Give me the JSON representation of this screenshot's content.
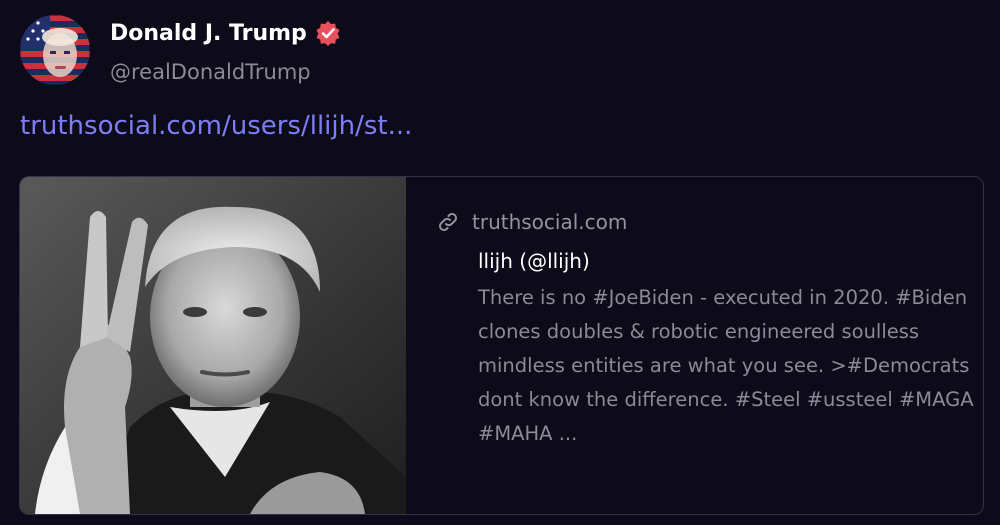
{
  "author": {
    "name": "Donald J. Trump",
    "handle": "@realDonaldTrump",
    "verified": true,
    "avatar_icon": "avatar-flag-face"
  },
  "post": {
    "link_text": "truthsocial.com/users/llijh/st..."
  },
  "link_card": {
    "domain": "truthsocial.com",
    "title": "llijh (@llijh)",
    "description": "There is no #JoeBiden - executed in 2020. #Biden clones doubles & robotic engineered soulless mindless entities are what you see. >#Democrats dont know the difference. #Steel #ussteel #MAGA #MAHA ...",
    "image": "photo-peace-sign"
  },
  "colors": {
    "background": "#0d0a1a",
    "link": "#7d7ef7",
    "verified_badge": "#e8505b",
    "muted_text": "#8c8a96",
    "card_border": "#34314a"
  }
}
